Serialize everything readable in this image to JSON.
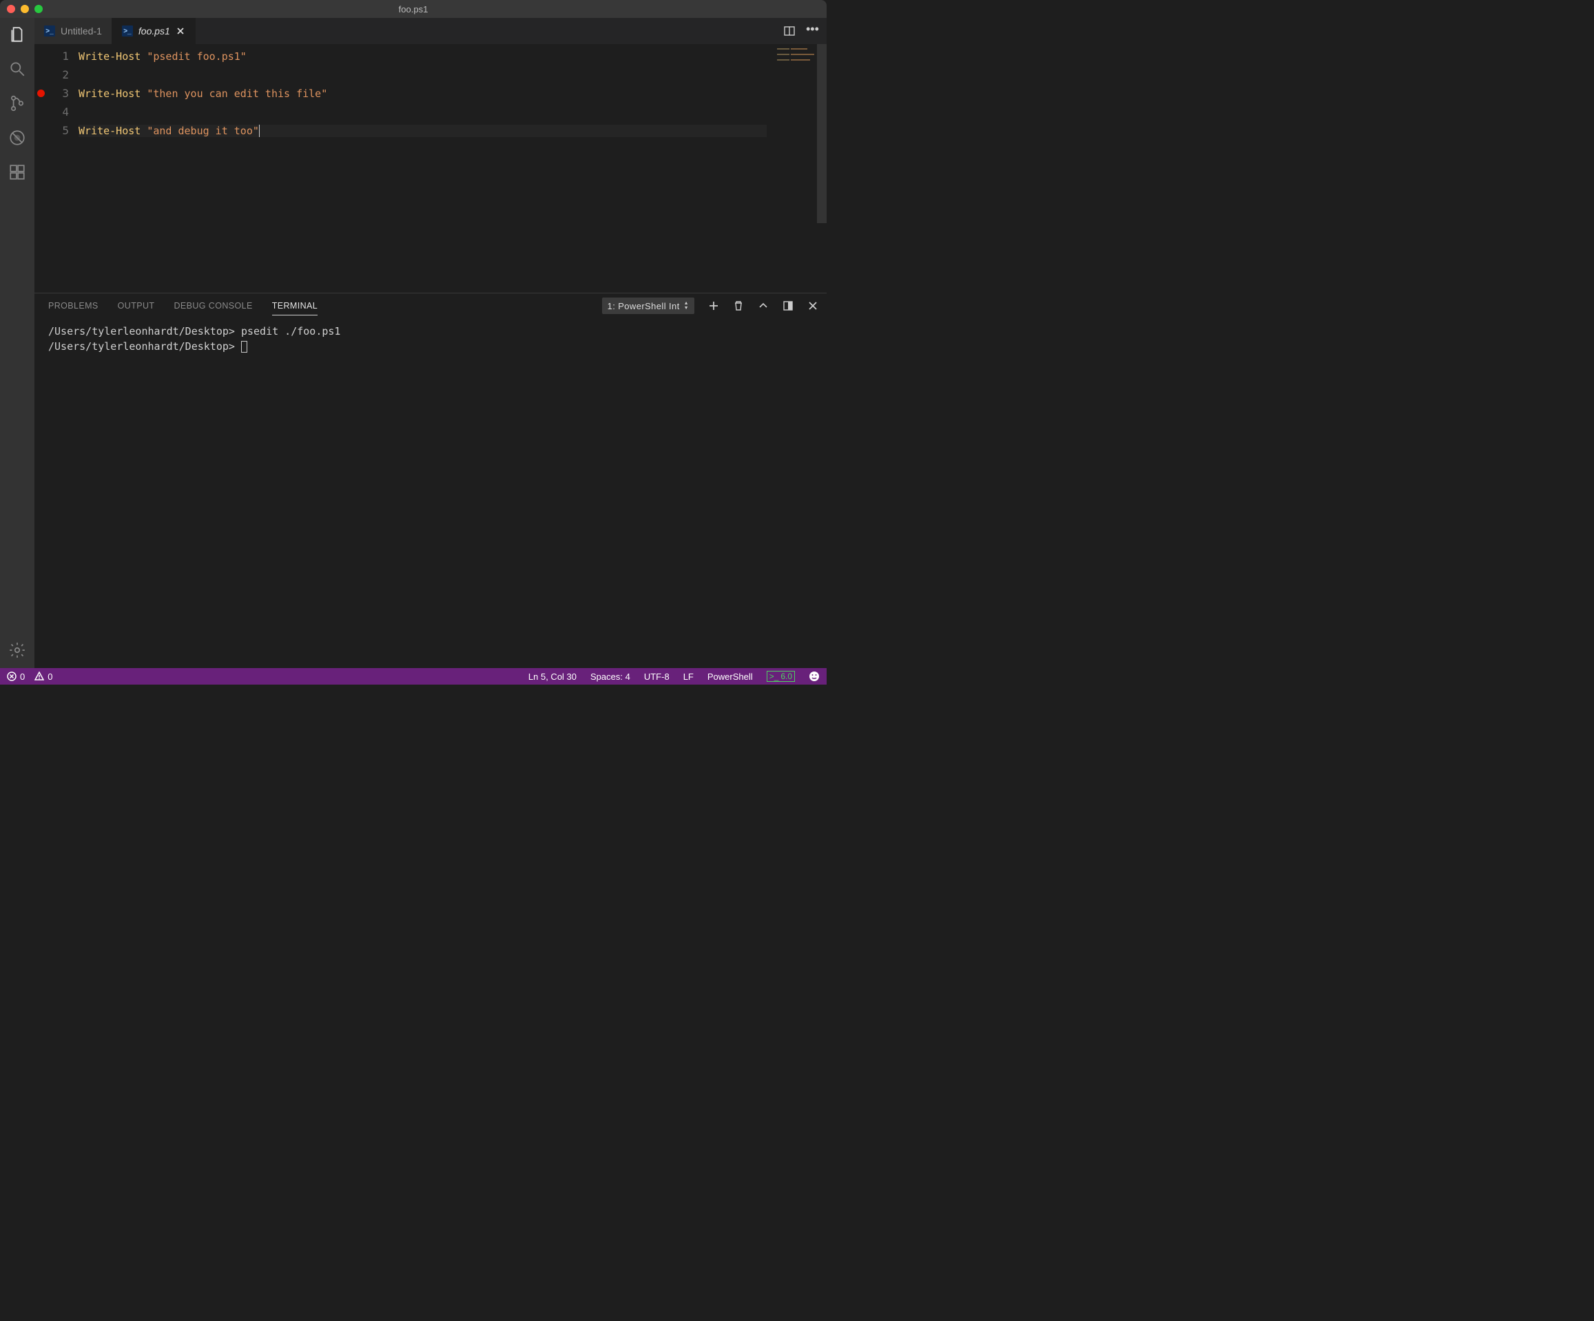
{
  "window": {
    "title": "foo.ps1"
  },
  "tabs": [
    {
      "label": "Untitled-1",
      "active": false
    },
    {
      "label": "foo.ps1",
      "active": true
    }
  ],
  "editor": {
    "lines": [
      {
        "n": "1",
        "bp": false,
        "cmd": "Write-Host",
        "str": "\"psedit foo.ps1\""
      },
      {
        "n": "2",
        "bp": false,
        "blank": true
      },
      {
        "n": "3",
        "bp": true,
        "cmd": "Write-Host",
        "str": "\"then you can edit this file\""
      },
      {
        "n": "4",
        "bp": false,
        "blank": true
      },
      {
        "n": "5",
        "bp": false,
        "cmd": "Write-Host",
        "str": "\"and debug it too\"",
        "cursor": true,
        "active": true
      }
    ]
  },
  "panel": {
    "tabs": {
      "problems": "PROBLEMS",
      "output": "OUTPUT",
      "debug": "DEBUG CONSOLE",
      "terminal": "TERMINAL"
    },
    "picker": "1: PowerShell Int",
    "terminal_lines": [
      {
        "prompt": "/Users/tylerleonhardt/Desktop>",
        "cmd": " psedit ./foo.ps1"
      },
      {
        "prompt": "/Users/tylerleonhardt/Desktop>",
        "cmd": " "
      }
    ]
  },
  "status": {
    "errors": "0",
    "warnings": "0",
    "cursor": "Ln 5, Col 30",
    "spaces": "Spaces: 4",
    "encoding": "UTF-8",
    "eol": "LF",
    "language": "PowerShell",
    "ps_version": "6.0"
  }
}
